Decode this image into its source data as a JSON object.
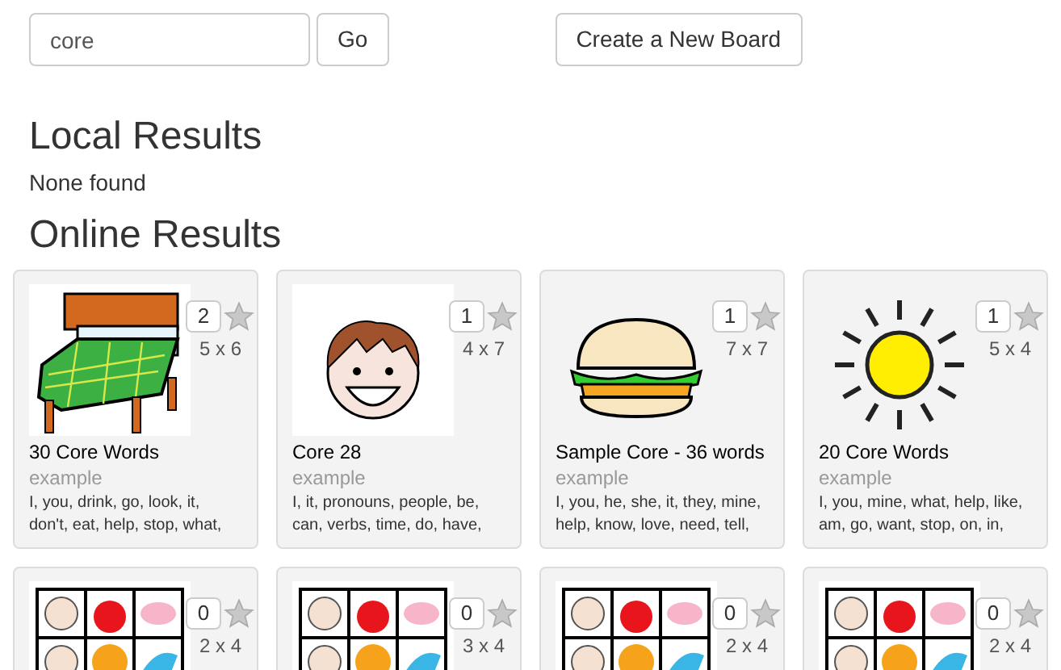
{
  "search": {
    "value": "core",
    "button": "Go"
  },
  "create_button": "Create a New Board",
  "local": {
    "heading": "Local Results",
    "empty": "None found"
  },
  "online": {
    "heading": "Online Results"
  },
  "boards": [
    {
      "kind": "bed",
      "count": "2",
      "starred": false,
      "size": "5 x 6",
      "title": "30 Core Words",
      "author": "example",
      "words": "I, you, drink, go, look, it, don't, eat, help, stop, what,"
    },
    {
      "kind": "face",
      "count": "1",
      "starred": false,
      "size": "4 x 7",
      "title": "Core 28",
      "author": "example",
      "words": "I, it, pronouns, people, be, can, verbs, time, do, have,"
    },
    {
      "kind": "burger",
      "count": "1",
      "starred": false,
      "size": "7 x 7",
      "title": "Sample Core - 36 words",
      "author": "example",
      "words": "I, you, he, she, it, they, mine, help, know, love, need, tell,"
    },
    {
      "kind": "sun",
      "count": "1",
      "starred": false,
      "size": "5 x 4",
      "title": "20 Core Words",
      "author": "example",
      "words": "I, you, mine, what, help, like, am, go, want, stop, on, in,"
    },
    {
      "kind": "grid",
      "count": "0",
      "starred": false,
      "size": "2 x 4"
    },
    {
      "kind": "grid",
      "count": "0",
      "starred": false,
      "size": "3 x 4"
    },
    {
      "kind": "grid",
      "count": "0",
      "starred": false,
      "size": "2 x 4"
    },
    {
      "kind": "grid",
      "count": "0",
      "starred": false,
      "size": "2 x 4"
    }
  ]
}
